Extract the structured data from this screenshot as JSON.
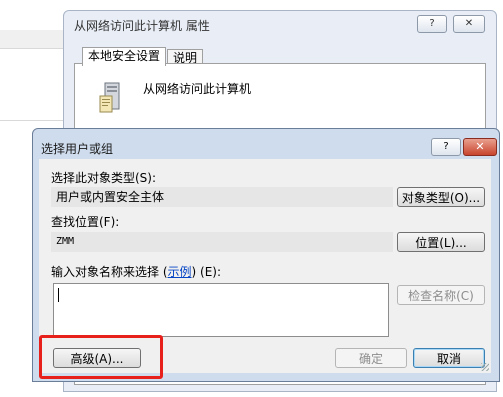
{
  "properties_window": {
    "title": "从网络访问此计算机 属性",
    "help_button": "?",
    "close_button": "✕",
    "tabs": [
      {
        "label": "本地安全设置",
        "selected": true
      },
      {
        "label": "说明",
        "selected": false
      }
    ],
    "policy_name": "从网络访问此计算机"
  },
  "select_users_dialog": {
    "title": "选择用户或组",
    "help_button": "?",
    "close_button": "✕",
    "object_type": {
      "label": "选择此对象类型(S):",
      "value": "用户或内置安全主体",
      "button": "对象类型(O)..."
    },
    "location": {
      "label": "查找位置(F):",
      "value": "ZMM",
      "button": "位置(L)..."
    },
    "object_names": {
      "label_prefix": "输入对象名称来选择 (",
      "label_link": "示例",
      "label_suffix": ") (E):",
      "value": "",
      "check_button": "检查名称(C)"
    },
    "advanced_button": "高级(A)...",
    "ok_button": "确定",
    "cancel_button": "取消"
  },
  "colors": {
    "highlight_box": "#e8201c",
    "dialog_frame": "#cfdced",
    "link": "#0645c5"
  }
}
